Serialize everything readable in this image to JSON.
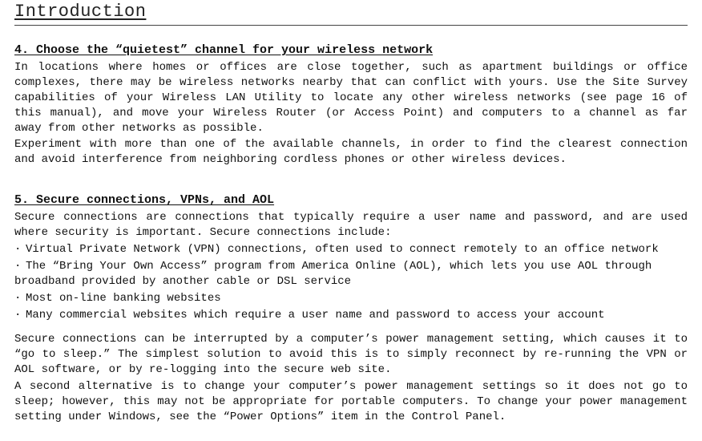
{
  "chapter": {
    "title": "Introduction"
  },
  "section4": {
    "heading": "4. Choose the “quietest” channel for your wireless network",
    "para1": "In locations where homes or offices are close together, such as apartment buildings or office complexes, there may be wireless networks nearby that can conflict with yours. Use the Site Survey capabilities of your Wireless LAN Utility to locate any other wireless networks (see page 16 of this manual), and move your Wireless Router (or Access Point) and computers to a channel as far away from other networks as possible.",
    "para2": "Experiment with more than one of the available channels, in order to find the clearest connection and avoid interference from neighboring cordless phones or other wireless devices."
  },
  "section5": {
    "heading": "5. Secure connections, VPNs, and AOL",
    "intro": "Secure connections are connections that typically require a user name and password, and are used where security is important. Secure connections include:",
    "bullets": {
      "0": "Virtual Private Network (VPN) connections, often used to connect remotely to an office network",
      "1": "The “Bring Your Own Access” program from America Online (AOL), which lets you use AOL through broadband provided by another cable or DSL service",
      "2": "Most on-line banking websites",
      "3": "Many commercial websites which require a user name and password to access your account"
    },
    "para_a": "Secure connections can be interrupted by a computer’s power management setting, which causes it to “go to sleep.” The simplest solution to avoid this is to simply reconnect by re-running the VPN or AOL software, or by re-logging into the secure web site.",
    "para_b": "A second alternative is to change your computer’s power management settings so it does not go to sleep; however, this may not be appropriate for portable computers. To change your power management setting under Windows, see the “Power Options” item in the Control Panel."
  },
  "bullet_char": "·"
}
